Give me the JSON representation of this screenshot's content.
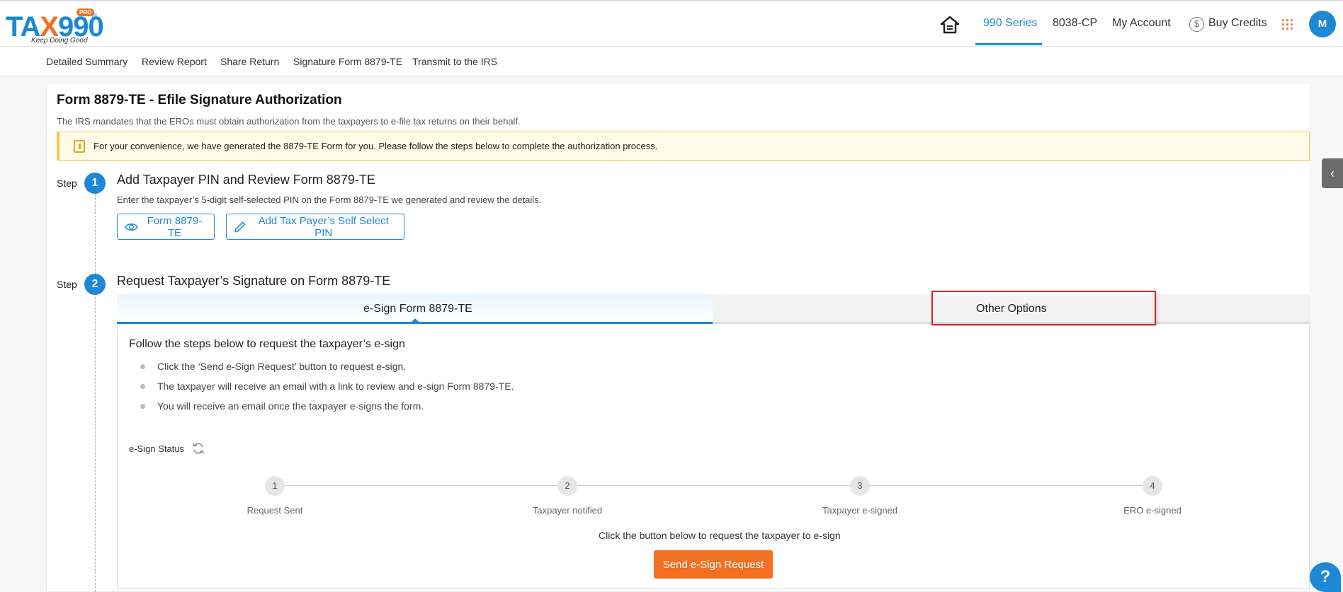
{
  "logo": {
    "main_a": "TA",
    "main_x": "X",
    "main_b": "990",
    "pro": "PRO",
    "reg": "®",
    "tagline": "Keep Doing Good"
  },
  "nav": {
    "items": [
      "990 Series",
      "8038-CP",
      "My Account",
      "Buy Credits"
    ],
    "active": "990 Series",
    "credit_symbol": "$",
    "avatar_initial": "M"
  },
  "subnav": [
    "Detailed Summary",
    "Review Report",
    "Share Return",
    "Signature Form 8879-TE",
    "Transmit to the IRS"
  ],
  "page": {
    "title": "Form 8879-TE - Efile Signature Authorization",
    "subtitle": "The IRS mandates that the EROs must obtain authorization from the taxpayers to e-file tax returns on their behalf.",
    "notice": "For your convenience, we have generated the 8879-TE Form for you. Please follow the steps below to complete the authorization process."
  },
  "step1": {
    "label": "Step",
    "number": "1",
    "title": "Add Taxpayer PIN and Review Form 8879-TE",
    "desc": "Enter the taxpayer’s 5-digit self-selected PIN on the Form 8879-TE we generated and review the details.",
    "btn_form": "Form 8879-TE",
    "btn_pin": "Add Tax Payer’s Self Select PIN"
  },
  "step2": {
    "label": "Step",
    "number": "2",
    "title": "Request Taxpayer’s Signature on Form 8879-TE",
    "tabs": [
      "e-Sign Form 8879-TE",
      "Other Options"
    ],
    "active_tab": "e-Sign Form 8879-TE",
    "panel_title": "Follow the steps below to request the taxpayer’s e-sign",
    "bullets": [
      "Click the ‘Send e-Sign Request’ button to request e-sign.",
      "The taxpayer will receive an email with a link to review and e-sign Form 8879-TE.",
      "You will receive an email once the taxpayer e-signs the form."
    ],
    "status_label": "e-Sign Status",
    "progress": [
      {
        "num": "1",
        "label": "Request Sent"
      },
      {
        "num": "2",
        "label": "Taxpayer notified"
      },
      {
        "num": "3",
        "label": "Taxpayer e-signed"
      },
      {
        "num": "4",
        "label": "ERO e-signed"
      }
    ],
    "helper": "Click the button below to request the taxpayer to e-sign",
    "send_button": "Send e-Sign Request"
  },
  "colors": {
    "brand_blue": "#1e88d6",
    "brand_orange": "#f36f21",
    "highlight_red": "#d9262c"
  },
  "side_toggle": "‹",
  "help": "?"
}
